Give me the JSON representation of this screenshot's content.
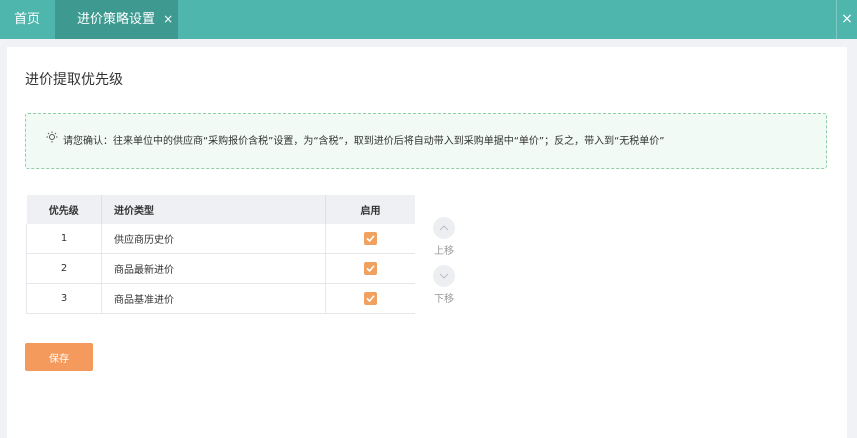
{
  "tabs": {
    "home": "首页",
    "active": "进价策略设置",
    "close_glyph": "×"
  },
  "window": {
    "close_glyph": "×"
  },
  "page": {
    "title": "进价提取优先级"
  },
  "notice": {
    "icon": "lightbulb-icon",
    "text": "请您确认：往来单位中的供应商“采购报价含税”设置，为“含税”，取到进价后将自动带入到采购单据中“单价”；反之，带入到“无税单价”"
  },
  "table": {
    "headers": [
      "优先级",
      "进价类型",
      "启用"
    ],
    "rows": [
      {
        "priority": "1",
        "type": "供应商历史价",
        "enabled": true
      },
      {
        "priority": "2",
        "type": "商品最新进价",
        "enabled": true
      },
      {
        "priority": "3",
        "type": "商品基准进价",
        "enabled": true
      }
    ]
  },
  "mover": {
    "up_label": "上移",
    "down_label": "下移"
  },
  "save_label": "保存",
  "colors": {
    "topbar": "#4fb6ad",
    "active_tab": "#3e9a91",
    "accent": "#f39a5c",
    "checkbox": "#f0a160",
    "notice_border": "#8fd0a8"
  }
}
